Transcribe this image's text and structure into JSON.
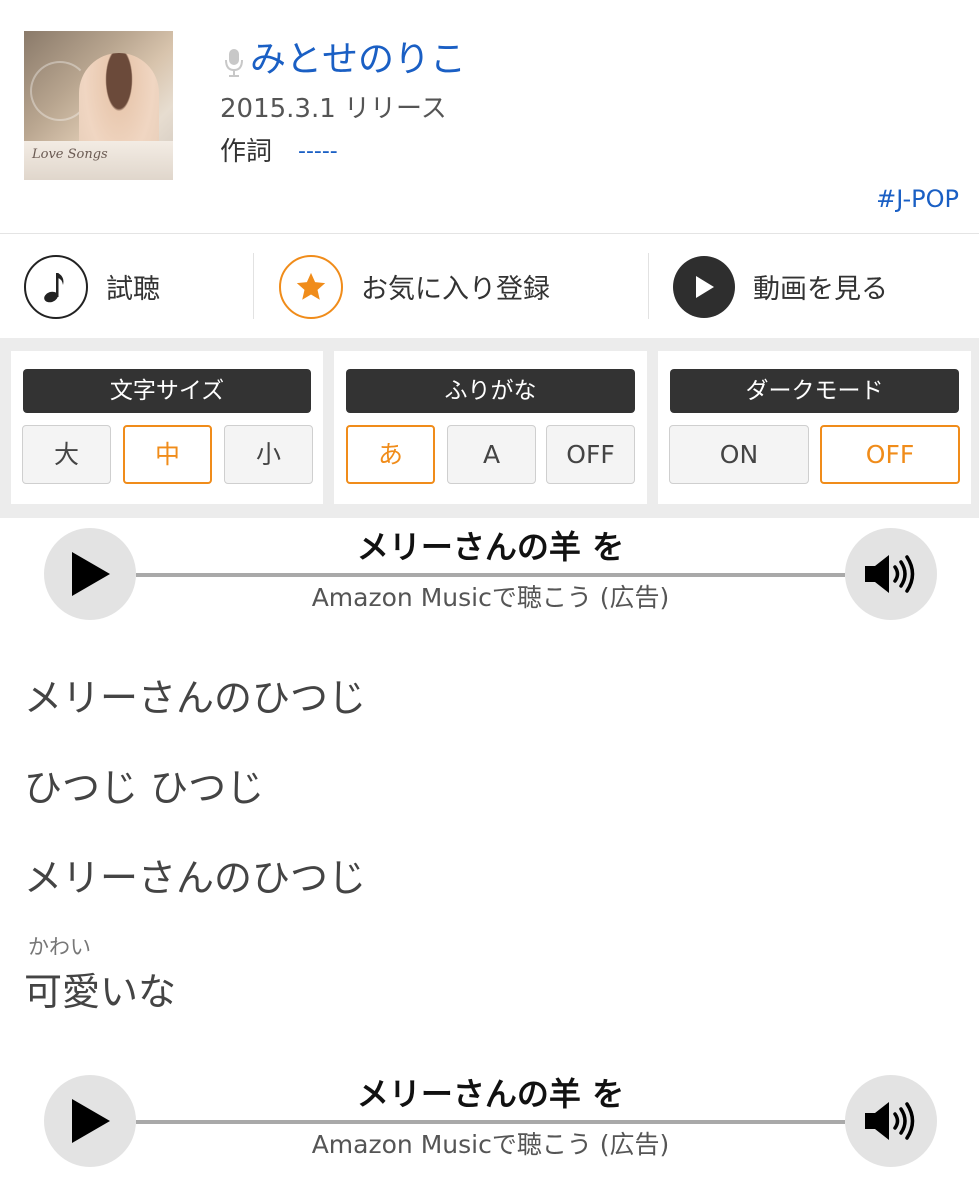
{
  "song": {
    "artist": "みとせのりこ",
    "release": "2015.3.1 リリース",
    "lyricist_label": "作詞",
    "lyricist_value": "-----",
    "genre_tag": "#J-POP",
    "album_logo_text": "Love Songs"
  },
  "actions": {
    "listen": "試聴",
    "favorite": "お気に入り登録",
    "video": "動画を見る"
  },
  "settings": {
    "font_size": {
      "title": "文字サイズ",
      "options": [
        "大",
        "中",
        "小"
      ],
      "selected": "中"
    },
    "furigana": {
      "title": "ふりがな",
      "options": [
        "あ",
        "A",
        "OFF"
      ],
      "selected": "あ"
    },
    "dark_mode": {
      "title": "ダークモード",
      "options": [
        "ON",
        "OFF"
      ],
      "selected": "OFF"
    }
  },
  "player": {
    "title": "メリーさんの羊 を",
    "subtitle": "Amazon Musicで聴こう (広告)"
  },
  "lyrics": {
    "line1": "メリーさんのひつじ",
    "line2": "ひつじ ひつじ",
    "line3": "メリーさんのひつじ",
    "line4_ruby": "かわい",
    "line4": "可愛いな"
  },
  "colors": {
    "link_blue": "#1a5fc4",
    "accent_orange": "#f08c1a",
    "dark": "#333333"
  }
}
